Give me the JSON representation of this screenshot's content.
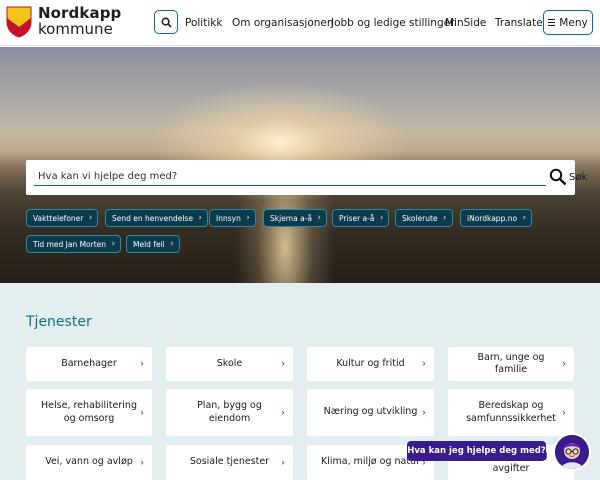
{
  "header": {
    "logo": {
      "line1": "Nordkapp",
      "line2": "kommune"
    },
    "search_icon": "magnifier-icon",
    "nav": [
      {
        "label": "Politikk"
      },
      {
        "label": "Om organisasjonen"
      },
      {
        "label": "Jobb og ledige stillinger"
      },
      {
        "label": "MinSide"
      },
      {
        "label": "Translate"
      }
    ],
    "menu_label": "Meny"
  },
  "hero": {
    "search_placeholder": "Hva kan vi hjelpe deg med?",
    "search_button": "Søk",
    "quick_links": [
      {
        "label": "Vakttelefoner"
      },
      {
        "label": "Send en henvendelse"
      },
      {
        "label": "Innsyn"
      },
      {
        "label": "Skjema a-å"
      },
      {
        "label": "Priser a-å"
      },
      {
        "label": "Skolerute"
      },
      {
        "label": "iNordkapp.no"
      },
      {
        "label": "Tid med Jan Morten"
      },
      {
        "label": "Meld feil"
      }
    ]
  },
  "services": {
    "title": "Tjenester",
    "cards": [
      {
        "label": "Barnehager"
      },
      {
        "label": "Skole"
      },
      {
        "label": "Kultur og fritid"
      },
      {
        "label": "Barn, unge og familie"
      },
      {
        "label": "Helse, rehabilitering og omsorg"
      },
      {
        "label": "Plan, bygg og eiendom"
      },
      {
        "label": "Næring og utvikling"
      },
      {
        "label": "Beredskap og samfunnssikkerhet"
      },
      {
        "label": "Vei, vann og avløp"
      },
      {
        "label": "Sosiale tjenester"
      },
      {
        "label": "Klima, miljø og natur"
      },
      {
        "label": "Skatt, gebyr og avgifter"
      }
    ]
  },
  "chatbot": {
    "label": "Hva kan jeg hjelpe deg med?"
  },
  "colors": {
    "accent": "#0e6f83",
    "chip_bg": "#0b3c4e",
    "services_bg": "#e2eef0",
    "chatbot": "#3b1a8c",
    "shield_red": "#c8102e",
    "shield_yellow": "#f2c318"
  }
}
